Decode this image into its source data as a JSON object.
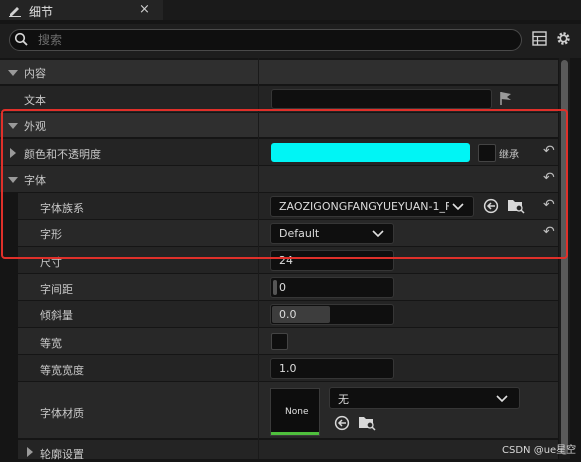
{
  "tab": {
    "title": "细节",
    "close": "×"
  },
  "search": {
    "placeholder": "搜索"
  },
  "sections": {
    "content": "内容",
    "appearance": "外观"
  },
  "rows": {
    "text_label": "文本",
    "color_label": "颜色和不透明度",
    "inherit_label": "继承",
    "font_label": "字体",
    "font_family_label": "字体族系",
    "font_family_value": "ZAOZIGONGFANGYUEYUAN-1_Fo",
    "typeface_label": "字形",
    "typeface_value": "Default",
    "size_label": "尺寸",
    "size_value": "24",
    "letter_spacing_label": "字间距",
    "letter_spacing_value": "0",
    "skew_label": "倾斜量",
    "skew_value": "0.0",
    "monospace_label": "等宽",
    "mono_width_label": "等宽宽度",
    "mono_width_value": "1.0",
    "font_material_label": "字体材质",
    "material_thumb": "None",
    "material_value": "无",
    "outline_label": "轮廓设置"
  },
  "colors": {
    "swatch": "#00f5f5",
    "highlight": "#e0302a"
  },
  "watermark": "CSDN @ue星空"
}
